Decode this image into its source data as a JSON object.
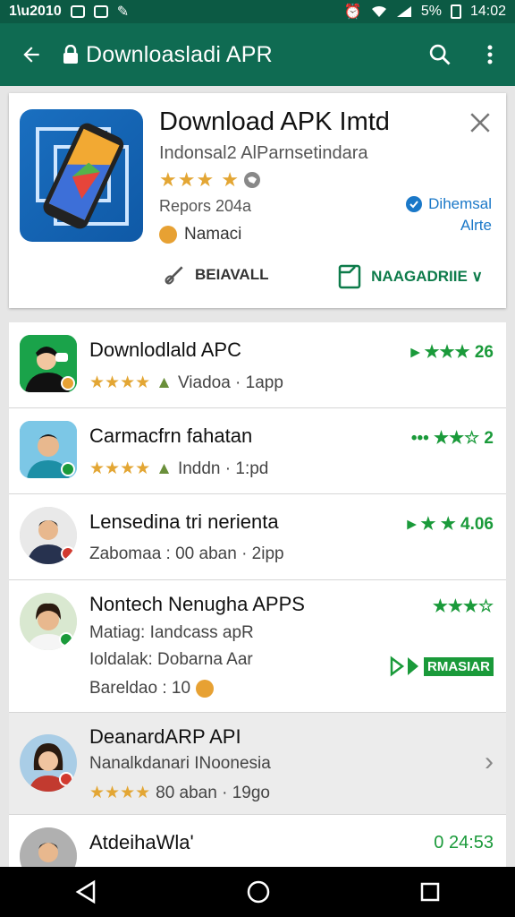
{
  "status": {
    "left": "1‐̃",
    "battery": "5%",
    "time": "14:02"
  },
  "app_bar": {
    "title": "Downloasladi APR"
  },
  "featured": {
    "title": "Download APK Imtd",
    "subtitle": "Indonsal2 AlParnsetindara",
    "stars": "★★★ ★",
    "reports": "Repors 204a",
    "named": "Namaci",
    "side_link_1": "Dihemsal",
    "side_link_2": "Alrte",
    "install_label": "BEIAVALL",
    "manage_label": "NAAGADRIIE ∨",
    "colors": {
      "accent": "#0f6b52",
      "star": "#e3a634",
      "link": "#1a78c8",
      "green": "#0d7b4a"
    }
  },
  "list": [
    {
      "title": "Downlodlald APC",
      "stars": "★★★★",
      "sub": "Viadoa · 1app",
      "right": "▸ ★★★ 26",
      "icon": "avatar-person-icon"
    },
    {
      "title": "Carmacfrn fahatan",
      "stars": "★★★★",
      "sub": "Inddn · 1:pd",
      "right": "••• ★★☆ 2",
      "icon": "avatar-person-icon"
    },
    {
      "title": "Lensedina tri nerienta",
      "stars": "",
      "sub": "Zabomaa : 00 aban · 2ipp",
      "right": "▸ ★ ★ 4.06",
      "icon": "avatar-person-icon"
    },
    {
      "title": "Nontech Nenugha APPS",
      "line2": "Matiag: Iandcass apR",
      "line3": "Ioldalak: Dobarna Aar",
      "sub": "Bareldao : 10",
      "right": "★★★☆",
      "badge_label": "RMASIAR",
      "icon": "avatar-person-icon"
    },
    {
      "title": "DeanardARP API",
      "line2": "Nanalkdanari INoonesia",
      "stars": "★★★★",
      "sub": "80 aban · 19go",
      "right": "›",
      "icon": "avatar-person-icon"
    },
    {
      "title": "AtdeihaWla'",
      "sub": "",
      "right": "0 24:53",
      "icon": "avatar-person-icon"
    }
  ]
}
